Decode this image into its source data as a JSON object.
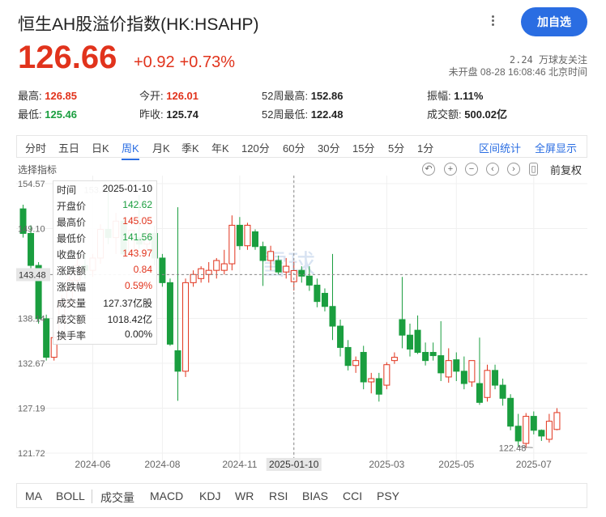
{
  "header": {
    "title": "恒生AH股溢价指数(HK:HSAHP)",
    "add_button": "加自选"
  },
  "quote": {
    "price": "126.66",
    "change": "+0.92",
    "change_pct": "+0.73%",
    "followers": "2.24 万球友关注",
    "status": "未开盘 08-28 16:08:46 北京时间"
  },
  "stats": {
    "high_label": "最高:",
    "high": "126.85",
    "low_label": "最低:",
    "low": "125.46",
    "open_label": "今开:",
    "open": "126.01",
    "prev_close_label": "昨收:",
    "prev_close": "125.74",
    "wk52_high_label": "52周最高:",
    "wk52_high": "152.86",
    "wk52_low_label": "52周最低:",
    "wk52_low": "122.48",
    "amplitude_label": "振幅:",
    "amplitude": "1.11%",
    "turnover_label": "成交额:",
    "turnover": "500.02亿"
  },
  "periods": [
    "分时",
    "五日",
    "日K",
    "周K",
    "月K",
    "季K",
    "年K",
    "120分",
    "60分",
    "30分",
    "15分",
    "5分",
    "1分"
  ],
  "active_period": "周K",
  "period_right": [
    "区间统计",
    "全屏显示"
  ],
  "toolbar": {
    "indicator_select": "选择指标",
    "adjust": "前复权"
  },
  "tooltip": {
    "rows": [
      {
        "label": "时间",
        "value": "2025-01-10",
        "color": "dark"
      },
      {
        "label": "开盘价",
        "value": "142.62",
        "color": "green"
      },
      {
        "label": "最高价",
        "value": "145.05",
        "color": "red"
      },
      {
        "label": "最低价",
        "value": "141.56",
        "color": "green"
      },
      {
        "label": "收盘价",
        "value": "143.97",
        "color": "red"
      },
      {
        "label": "涨跌额",
        "value": "0.84",
        "color": "red"
      },
      {
        "label": "涨跌幅",
        "value": "0.59%",
        "color": "red"
      },
      {
        "label": "成交量",
        "value": "127.37亿股",
        "color": "dark"
      },
      {
        "label": "成交额",
        "value": "1018.42亿",
        "color": "dark"
      },
      {
        "label": "换手率",
        "value": "0.00%",
        "color": "dark"
      }
    ]
  },
  "chart_data": {
    "type": "candlestick",
    "y_ticks": [
      "154.57",
      "149.10",
      "143.48",
      "138.14",
      "132.67",
      "127.19",
      "121.72"
    ],
    "ylim": [
      121.72,
      154.57
    ],
    "x_ticks": [
      "2024-06",
      "2024-08",
      "2024-11",
      "2025-01-10",
      "2025-03",
      "2025-05",
      "2025-07"
    ],
    "crosshair_value": "143.48",
    "crosshair_date": "2025-01-10",
    "max_label": "153.81",
    "min_label": "122.48",
    "up_color": "#e1331c",
    "down_color": "#1a9e3f",
    "candles": [
      [
        151.5,
        152.0,
        148.0,
        148.5
      ],
      [
        148.5,
        149.5,
        144.0,
        144.6
      ],
      [
        144.6,
        145.0,
        137.5,
        138.1
      ],
      [
        138.1,
        138.6,
        133.0,
        133.4
      ],
      [
        133.4,
        136.5,
        133.0,
        135.8
      ],
      [
        135.8,
        141.0,
        135.5,
        140.2
      ],
      [
        140.2,
        143.5,
        139.5,
        142.8
      ],
      [
        142.8,
        145.5,
        142.0,
        144.6
      ],
      [
        144.6,
        146.0,
        143.0,
        144.0
      ],
      [
        144.0,
        146.0,
        143.2,
        145.5
      ],
      [
        145.5,
        149.6,
        144.8,
        149.0
      ],
      [
        149.0,
        153.81,
        147.2,
        148.0
      ],
      [
        148.0,
        151.0,
        146.0,
        150.0
      ],
      [
        150.0,
        150.5,
        145.4,
        146.0
      ],
      [
        146.0,
        146.5,
        148.5,
        148.9
      ],
      [
        148.0,
        153.2,
        146.6,
        147.2
      ],
      [
        147.2,
        149.0,
        146.0,
        148.5
      ],
      [
        148.5,
        149.4,
        144.6,
        145.5
      ],
      [
        145.5,
        146.0,
        142.0,
        142.5
      ],
      [
        142.5,
        143.0,
        134.8,
        135.0
      ],
      [
        134.2,
        151.7,
        128.1,
        131.7
      ],
      [
        131.7,
        143.0,
        131.0,
        142.5
      ],
      [
        142.5,
        144.0,
        142.0,
        143.5
      ],
      [
        143.0,
        144.5,
        142.5,
        144.2
      ],
      [
        143.5,
        145.0,
        142.5,
        144.0
      ],
      [
        144.0,
        145.5,
        143.0,
        145.2
      ],
      [
        144.0,
        146.5,
        143.5,
        144.8
      ],
      [
        144.8,
        150.7,
        144.0,
        149.5
      ],
      [
        149.5,
        150.5,
        146.5,
        147.0
      ],
      [
        147.0,
        149.8,
        146.5,
        149.5
      ],
      [
        148.7,
        149.0,
        146.5,
        146.9
      ],
      [
        146.9,
        147.5,
        142.1,
        145.2
      ],
      [
        145.2,
        147.0,
        144.0,
        146.3
      ],
      [
        145.2,
        145.8,
        143.5,
        143.8
      ],
      [
        143.8,
        145.5,
        143.0,
        144.5
      ],
      [
        142.62,
        145.05,
        141.56,
        143.97
      ],
      [
        144.0,
        144.5,
        142.5,
        143.3
      ],
      [
        143.3,
        144.5,
        141.5,
        142.2
      ],
      [
        142.2,
        143.0,
        139.5,
        140.2
      ],
      [
        141.2,
        141.8,
        139.0,
        139.6
      ],
      [
        139.6,
        146.0,
        135.5,
        137.2
      ],
      [
        137.2,
        138.0,
        133.5,
        134.6
      ],
      [
        134.6,
        135.5,
        131.8,
        132.4
      ],
      [
        132.4,
        133.5,
        131.5,
        133.0
      ],
      [
        134.0,
        134.8,
        129.5,
        130.4
      ],
      [
        130.4,
        131.5,
        129.0,
        130.8
      ],
      [
        130.8,
        131.5,
        128.0,
        128.9
      ],
      [
        130.0,
        132.8,
        129.5,
        132.5
      ],
      [
        133.0,
        134.0,
        132.6,
        133.4
      ],
      [
        138.0,
        143.2,
        134.5,
        136.1
      ],
      [
        136.1,
        137.5,
        133.5,
        134.4
      ],
      [
        136.7,
        138.5,
        133.8,
        134.0
      ],
      [
        134.0,
        135.2,
        132.4,
        133.0
      ],
      [
        134.0,
        135.2,
        133.0,
        133.6
      ],
      [
        133.6,
        137.8,
        130.5,
        131.5
      ],
      [
        131.0,
        134.5,
        130.3,
        133.0
      ],
      [
        133.1,
        134.0,
        130.5,
        131.7
      ],
      [
        131.7,
        133.5,
        129.5,
        130.2
      ],
      [
        130.4,
        132.8,
        129.8,
        133.0
      ],
      [
        130.2,
        135.8,
        127.6,
        127.9
      ],
      [
        128.5,
        132.5,
        128.0,
        131.8
      ],
      [
        131.8,
        132.5,
        129.5,
        130.0
      ],
      [
        130.0,
        130.8,
        127.5,
        128.4
      ],
      [
        128.4,
        128.9,
        124.5,
        125.0
      ],
      [
        125.0,
        126.5,
        122.48,
        123.2
      ],
      [
        122.9,
        126.6,
        122.3,
        126.2
      ],
      [
        126.2,
        126.8,
        124.0,
        124.5
      ],
      [
        124.5,
        124.6,
        123.2,
        123.8
      ],
      [
        123.4,
        126.5,
        123.0,
        125.6
      ],
      [
        124.6,
        127.2,
        124.5,
        126.66
      ]
    ]
  },
  "indicators": [
    "MA",
    "BOLL",
    "成交量",
    "MACD",
    "KDJ",
    "WR",
    "RSI",
    "BIAS",
    "CCI",
    "PSY"
  ],
  "watermark": "雪球"
}
